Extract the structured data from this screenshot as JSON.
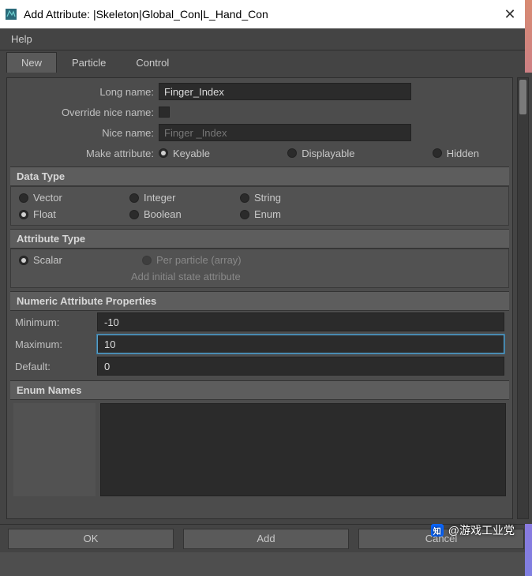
{
  "title": "Add Attribute: |Skeleton|Global_Con|L_Hand_Con",
  "menu": {
    "help": "Help"
  },
  "tabs": {
    "new": "New",
    "particle": "Particle",
    "control": "Control"
  },
  "names": {
    "long_label": "Long name:",
    "long_value": "Finger_Index",
    "override_label": "Override nice name:",
    "nice_label": "Nice name:",
    "nice_value": "Finger _Index",
    "make_label": "Make attribute:"
  },
  "make_opts": {
    "keyable": "Keyable",
    "displayable": "Displayable",
    "hidden": "Hidden"
  },
  "sections": {
    "datatype": "Data Type",
    "attrtype": "Attribute Type",
    "numeric": "Numeric Attribute Properties",
    "enum": "Enum Names"
  },
  "datatype": {
    "vector": "Vector",
    "integer": "Integer",
    "string": "String",
    "float": "Float",
    "boolean": "Boolean",
    "enum": "Enum"
  },
  "attrtype": {
    "scalar": "Scalar",
    "perparticle": "Per particle (array)",
    "addinitial": "Add initial state attribute"
  },
  "numeric": {
    "min_label": "Minimum:",
    "min_value": "-10",
    "max_label": "Maximum:",
    "max_value": "10",
    "def_label": "Default:",
    "def_value": "0"
  },
  "buttons": {
    "ok": "OK",
    "add": "Add",
    "cancel": "Cancel"
  },
  "watermark": "@游戏工业党"
}
